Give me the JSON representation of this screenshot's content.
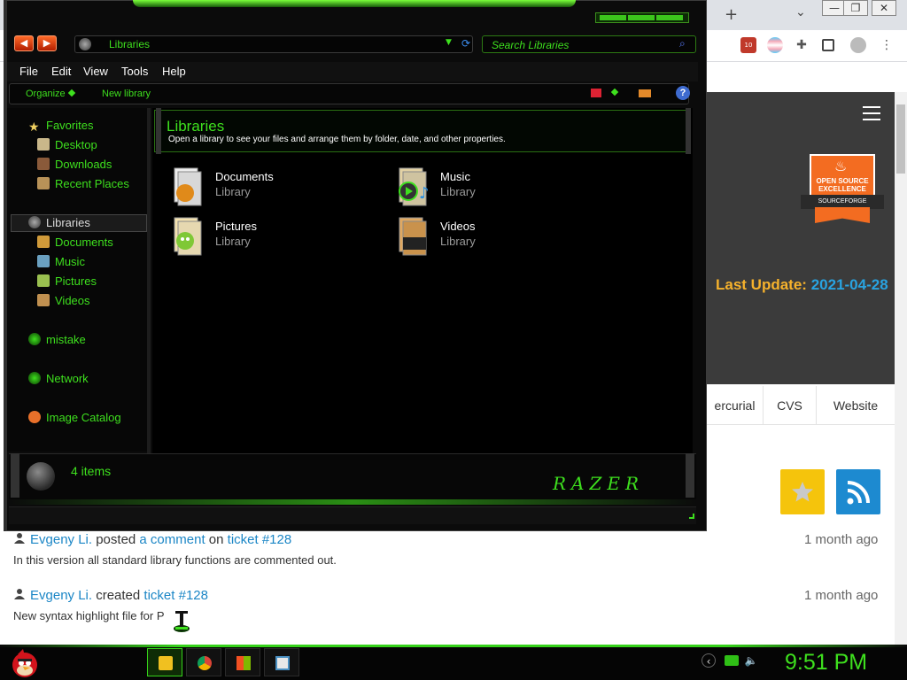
{
  "browser": {
    "window_controls": {
      "minimize": "—",
      "restore": "❐",
      "close": "✕"
    },
    "new_tab_icon": "plus-icon",
    "tab_dropdown_icon": "chevron-down-icon",
    "extensions_badge": "10",
    "site": {
      "badge_line1": "OPEN SOURCE EXCELLENCE",
      "badge_line2": "SOURCEFORGE",
      "last_update_label": "Last Update:",
      "last_update_date": "2021-04-28",
      "tabs": [
        "ercurial",
        "CVS",
        "Website"
      ],
      "colors": {
        "header_bg": "#3b3b3b",
        "accent_orange": "#f36c21",
        "accent_yellow": "#f6b22c",
        "link_blue": "#1b86c6"
      },
      "feed": [
        {
          "user": "Evgeny Li.",
          "action": " posted ",
          "object": "a comment",
          "preposition": " on ",
          "target": "ticket #128",
          "time": "1 month ago",
          "body": "In this version all standard library functions are commented out."
        },
        {
          "user": "Evgeny Li.",
          "action": " created ",
          "target": "ticket #128",
          "time": "1 month ago",
          "body": "New syntax highlight file for P"
        }
      ]
    }
  },
  "explorer": {
    "address": "Libraries",
    "search_placeholder": "Search Libraries",
    "menu": [
      "File",
      "Edit",
      "View",
      "Tools",
      "Help"
    ],
    "commands": {
      "organize": "Organize",
      "new_library": "New library",
      "help": "?"
    },
    "nav": {
      "favorites": "Favorites",
      "favorites_items": [
        "Desktop",
        "Downloads",
        "Recent Places"
      ],
      "libraries": "Libraries",
      "libraries_items": [
        "Documents",
        "Music",
        "Pictures",
        "Videos"
      ],
      "homegroup": "mistake",
      "network": "Network",
      "image_catalog": "Image Catalog"
    },
    "banner": {
      "title": "Libraries",
      "subtitle": "Open a library to see your files and arrange them by folder, date, and other properties."
    },
    "libraries": [
      {
        "name": "Documents",
        "type": "Library"
      },
      {
        "name": "Music",
        "type": "Library"
      },
      {
        "name": "Pictures",
        "type": "Library"
      },
      {
        "name": "Videos",
        "type": "Library"
      }
    ],
    "status": {
      "count": "4 items"
    },
    "logo_text": "RAZER",
    "colors": {
      "accent_green": "#3ee01e",
      "window_bg": "#0b0b0b"
    }
  },
  "taskbar": {
    "clock": "9:51 PM",
    "pinned": [
      "explorer-icon",
      "chrome-icon",
      "windows-icon",
      "app-icon"
    ]
  }
}
